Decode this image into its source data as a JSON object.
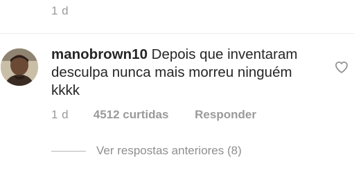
{
  "previous_comment": {
    "time": "1 d"
  },
  "comment": {
    "username": "manobrown10",
    "text": "Depois que inventaram desculpa nunca mais morreu ninguém kkkk",
    "time": "1 d",
    "likes": "4512 curtidas",
    "reply_label": "Responder",
    "like_icon": "heart-outline-icon"
  },
  "replies": {
    "label": "Ver respostas anteriores (8)"
  },
  "colors": {
    "text": "#262626",
    "muted": "#9a9a9a",
    "background": "#ffffff"
  }
}
